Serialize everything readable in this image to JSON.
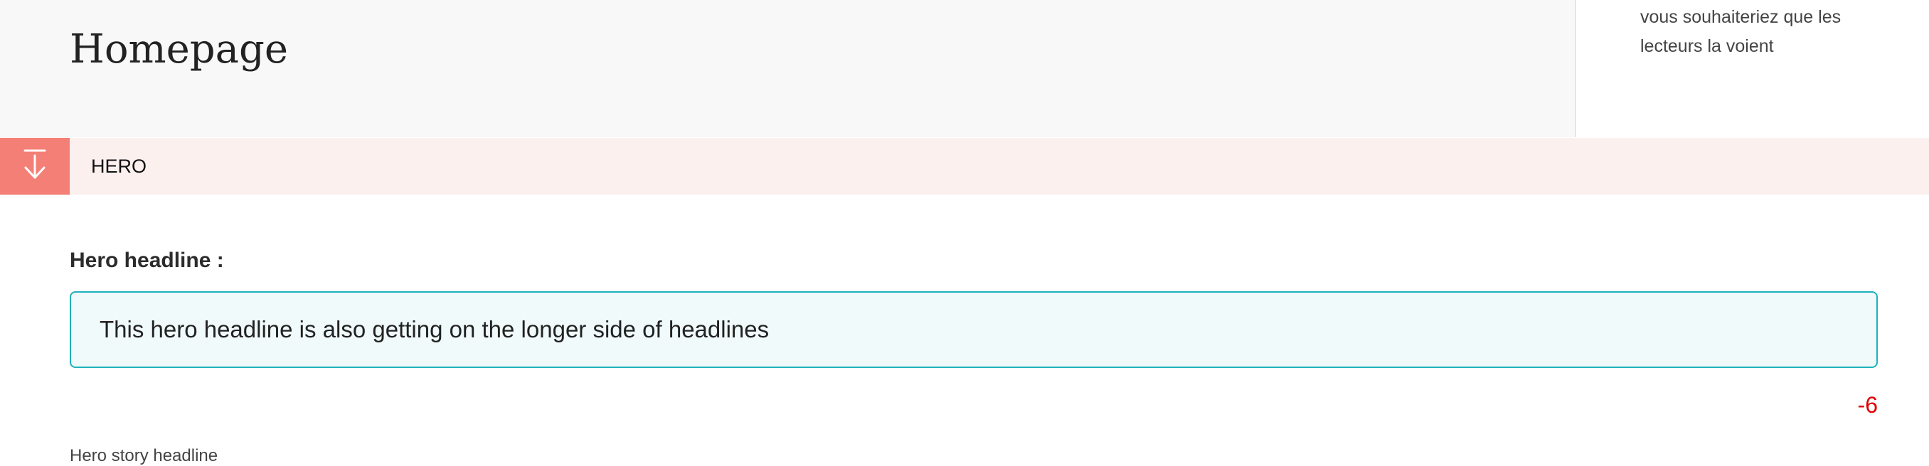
{
  "header": {
    "title": "Homepage"
  },
  "side_panel": {
    "text": "vous souhaiteriez que les lecteurs la voient"
  },
  "section": {
    "label": "HERO",
    "toggle_icon": "arrow-down-to-line-icon"
  },
  "hero_headline": {
    "label": "Hero headline :",
    "value": "This hero headline is also getting on the longer side of headlines",
    "char_count": "-6"
  },
  "hero_story": {
    "label": "Hero story headline"
  },
  "colors": {
    "section_accent": "#f47f76",
    "section_bg": "#fcf0ef",
    "input_border": "#1fb2bb",
    "input_bg": "#f0fafa",
    "count_negative": "#e00000"
  }
}
